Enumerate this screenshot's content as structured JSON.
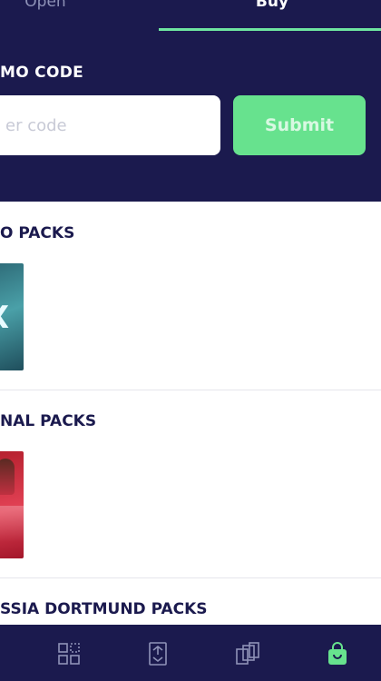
{
  "tabs": {
    "open_label": "Open",
    "buy_label": "Buy"
  },
  "promo": {
    "label": "MO CODE",
    "placeholder": "er code",
    "submit_label": "Submit"
  },
  "sections": [
    {
      "title": "O PACKS",
      "pack_letter": "X"
    },
    {
      "title": "NAL PACKS"
    },
    {
      "title": "SSIA DORTMUND PACKS"
    }
  ],
  "bottom_nav": {
    "items": [
      "collection-grid-icon",
      "trade-icon",
      "cards-icon",
      "shop-bag-icon"
    ],
    "active": "shop-bag-icon"
  },
  "colors": {
    "header_bg": "#1b1a4e",
    "accent_green": "#67e28e",
    "text_dark": "#1b1a4e"
  }
}
